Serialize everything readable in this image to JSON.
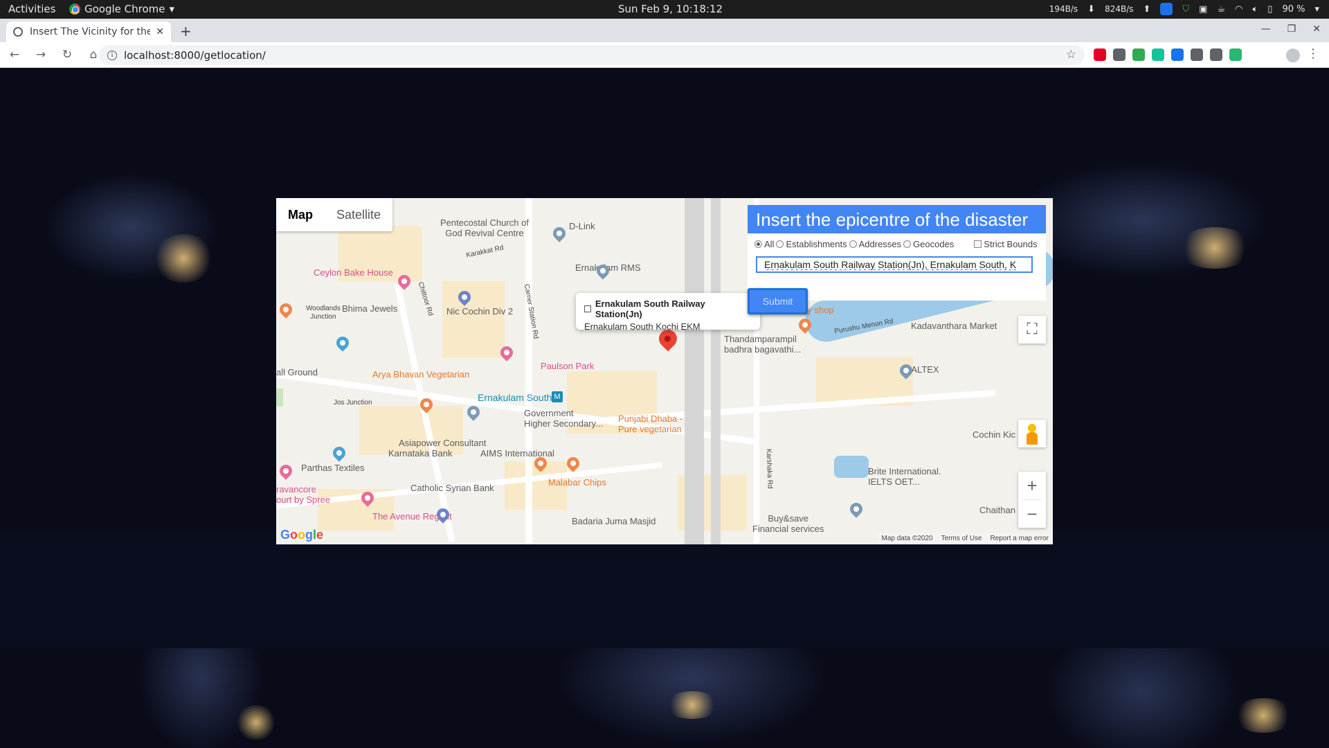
{
  "system": {
    "activities": "Activities",
    "app_name": "Google Chrome",
    "clock": "Sun Feb  9, 10:18:12",
    "net_down": "194B/s",
    "net_up": "824B/s",
    "battery": "90 %"
  },
  "browser": {
    "tab_title": "Insert The Vicinity for the",
    "url": "localhost:8000/getlocation/",
    "extension_colors": [
      "#e60023",
      "#5f6368",
      "#34a853",
      "#15c39a",
      "#1a73e8",
      "#5f6368",
      "#5f6368",
      "#2bb673"
    ]
  },
  "map": {
    "map_type_buttons": [
      "Map",
      "Satellite"
    ],
    "selected_map_type": "Map",
    "google_logo": "Google",
    "attribution": [
      "Map data ©2020",
      "Terms of Use",
      "Report a map error"
    ],
    "labels": {
      "pentecostal": "Pentecostal Church of\nGod Revival Centre",
      "dlink": "D-Link",
      "ceylon": "Ceylon Bake House",
      "bhima": "Bhima Jewels",
      "woodlands": "Woodlands\nJunction",
      "nic": "Nic Cochin Div 2",
      "rms": "Ernakulam RMS",
      "karakkat": "Karakkat Rd",
      "chittoor": "Chittoor Rd",
      "carrier": "Carrier Station Rd",
      "paulson": "Paulson Park",
      "arya": "Arya Bhavan Vegetarian",
      "south": "Ernakulam South",
      "jos": "Jos Junction",
      "govt": "Government\nHigher Secondary...",
      "punjabi": "Punjabi Dhaba -\nPure vegetarian",
      "asiapower": "Asiapower Consultant",
      "karnataka": "Karnataka Bank",
      "aims": "AIMS International",
      "parthas": "Parthas Textiles",
      "catholic": "Catholic Syrian Bank",
      "malabar": "Malabar Chips",
      "avenue": "The Avenue Regent",
      "badaria": "Badaria Juma Masjid",
      "trivancore": "ravancore\nourt by Spree",
      "hall": "all Ground",
      "thandam": "Thandamparampil\nbadhra bagavathi...",
      "curry": "The curry shop",
      "purushu": "Purushu Menon Rd",
      "kadavanthara": "Kadavanthara Market",
      "caltex": "CALTEX",
      "cochin": "Cochin Kic",
      "brite": "Brite International.\nIELTS OET...",
      "buysave": "Buy&save\nFinancial services",
      "karshaka": "Karshaka Rd",
      "chaithan": "Chaithan"
    },
    "info_window": {
      "title": "Ernakulam South Railway Station(Jn)",
      "subtitle": "Ernakulam South Kochi EKM"
    }
  },
  "panel": {
    "heading": "Insert the epicentre of the disaster",
    "radio_options": [
      "All",
      "Establishments",
      "Addresses",
      "Geocodes"
    ],
    "selected_option": "All",
    "checkbox_label": "Strict Bounds",
    "input_value": "Ernakulam South Railway Station(Jn), Ernakulam South, K",
    "submit_label": "Submit"
  }
}
